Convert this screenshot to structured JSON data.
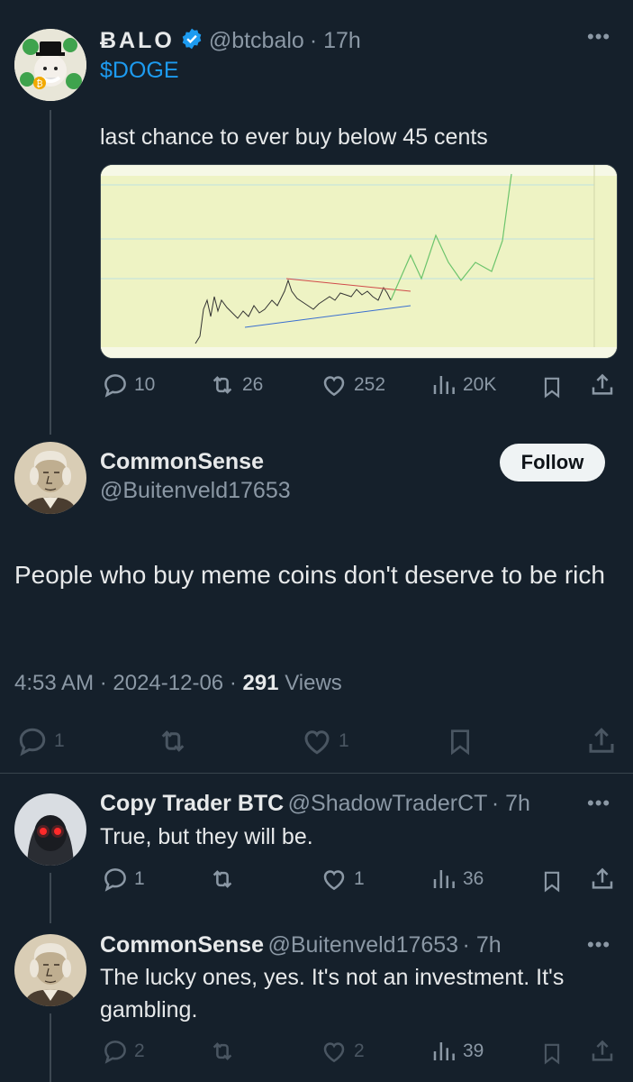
{
  "post1": {
    "name": "ɃALO",
    "handle": "@btcbalo",
    "time": "· 17h",
    "ticker": "$DOGE",
    "text": "last chance to ever buy below 45 cents",
    "stats": {
      "replies": "10",
      "reposts": "26",
      "likes": "252",
      "views": "20K"
    }
  },
  "main": {
    "name": "CommonSense",
    "handle": "@Buitenveld17653",
    "follow_label": "Follow",
    "text": "People who buy meme coins don't deserve to be rich",
    "time": "4:53 AM · 2024-12-06 ·",
    "views_count": "291",
    "views_label": "Views",
    "stats": {
      "replies": "1",
      "likes": "1"
    }
  },
  "reply1": {
    "name": "Copy Trader BTC",
    "handle": "@ShadowTraderCT",
    "time": "· 7h",
    "text": "True, but they will be.",
    "stats": {
      "replies": "1",
      "likes": "1",
      "views": "36"
    }
  },
  "reply2": {
    "name": "CommonSense",
    "handle": "@Buitenveld17653",
    "time": "· 7h",
    "text": "The lucky ones, yes. It's not an investment. It's gambling.",
    "stats": {
      "replies": "2",
      "likes": "2",
      "views": "39"
    }
  },
  "colors": {
    "background": "#15202b",
    "accent": "#1d9bf0",
    "muted": "#8b98a5",
    "chart_bg": "#f0f3c8"
  },
  "icons": [
    "verified-badge-icon",
    "more-icon",
    "reply-icon",
    "repost-icon",
    "like-icon",
    "views-icon",
    "bookmark-icon",
    "share-icon"
  ]
}
